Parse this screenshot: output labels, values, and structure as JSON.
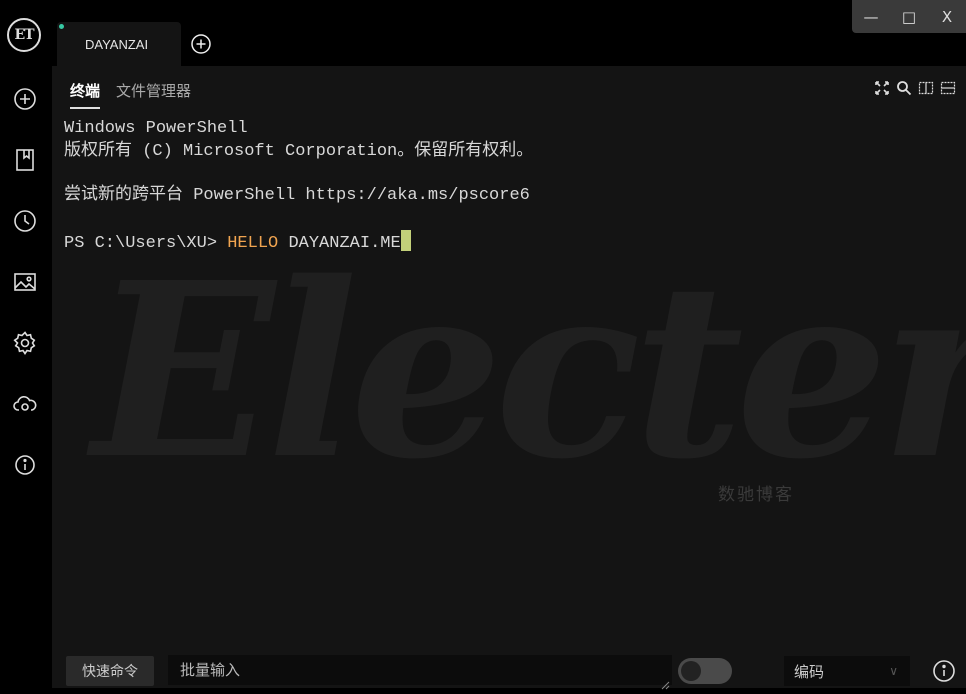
{
  "sidebar": {
    "logo": "ET",
    "icons": [
      "add-icon",
      "bookmark-icon",
      "history-icon",
      "image-icon",
      "gear-icon",
      "cloud-sync-icon",
      "info-icon"
    ]
  },
  "tabs": [
    {
      "label": "DAYANZAI",
      "active": true
    }
  ],
  "window_controls": {
    "minimize": "—",
    "maximize": "□",
    "close": "X"
  },
  "subtabs": [
    "终端",
    "文件管理器"
  ],
  "terminal": {
    "lines": [
      "Windows PowerShell",
      "版权所有 (C) Microsoft Corporation。保留所有权利。",
      "尝试新的跨平台 PowerShell https://aka.ms/pscore6"
    ],
    "prompt": "PS C:\\Users\\XU> ",
    "command": "HELLO",
    "argument": " DAYANZAI.ME"
  },
  "watermark": {
    "logo_text": "Electerm",
    "text": "数驰博客"
  },
  "bottombar": {
    "quick_command": "快速命令",
    "batch_input_placeholder": "批量输入",
    "encoding_label": "编码"
  },
  "colors": {
    "accent": "#37c9a4",
    "command": "#f0a450",
    "cursor": "#c3d07a",
    "panel": "#141414"
  }
}
